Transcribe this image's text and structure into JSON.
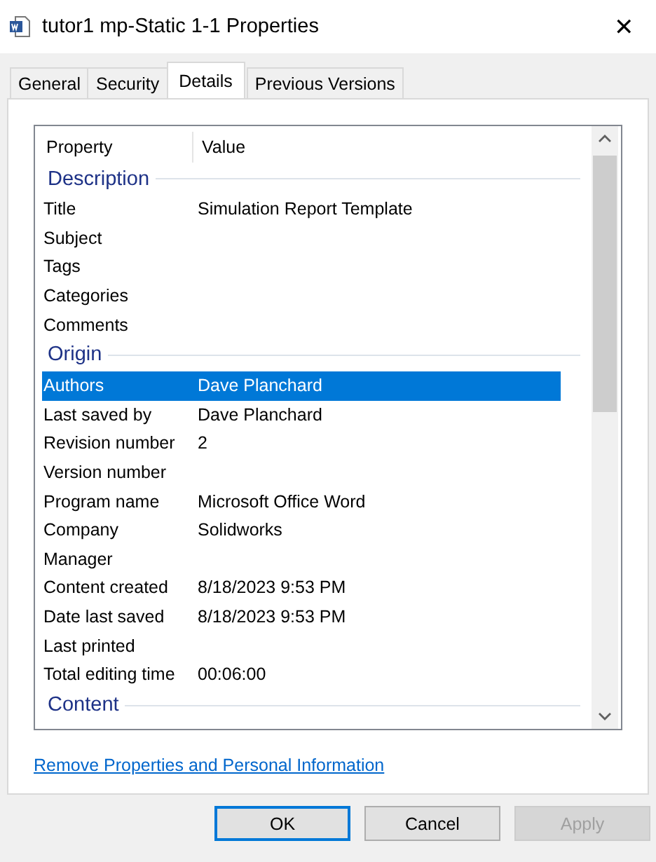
{
  "window": {
    "title": "tutor1 mp-Static 1-1 Properties",
    "close": "✕"
  },
  "tabs": [
    {
      "label": "General",
      "selected": false
    },
    {
      "label": "Security",
      "selected": false
    },
    {
      "label": "Details",
      "selected": true
    },
    {
      "label": "Previous Versions",
      "selected": false
    }
  ],
  "table": {
    "columns": [
      "Property",
      "Value"
    ],
    "groups": [
      {
        "name": "Description",
        "rows": [
          {
            "property": "Title",
            "value": "Simulation Report Template",
            "selected": false
          },
          {
            "property": "Subject",
            "selected": false
          },
          {
            "property": "Tags",
            "selected": false
          },
          {
            "property": "Categories",
            "selected": false
          },
          {
            "property": "Comments",
            "selected": false
          }
        ]
      },
      {
        "name": "Origin",
        "rows": [
          {
            "property": "Authors",
            "value": "Dave Planchard",
            "selected": true
          },
          {
            "property": "Last saved by",
            "value": "Dave Planchard",
            "selected": false
          },
          {
            "property": "Revision number",
            "value": "2",
            "selected": false
          },
          {
            "property": "Version number",
            "selected": false
          },
          {
            "property": "Program name",
            "value": "Microsoft Office Word",
            "selected": false
          },
          {
            "property": "Company",
            "value": "Solidworks",
            "selected": false
          },
          {
            "property": "Manager",
            "selected": false
          },
          {
            "property": "Content created",
            "value": "8/18/2023 9:53 PM",
            "selected": false
          },
          {
            "property": "Date last saved",
            "value": "8/18/2023 9:53 PM",
            "selected": false
          },
          {
            "property": "Last printed",
            "selected": false
          },
          {
            "property": "Total editing time",
            "value": "00:06:00",
            "selected": false
          }
        ]
      },
      {
        "name": "Content"
      }
    ]
  },
  "link": "Remove Properties and Personal Information",
  "buttons": [
    {
      "label": "OK",
      "default": true,
      "disabled": false
    },
    {
      "label": "Cancel",
      "default": false,
      "disabled": false
    },
    {
      "label": "Apply",
      "default": false,
      "disabled": true
    }
  ]
}
